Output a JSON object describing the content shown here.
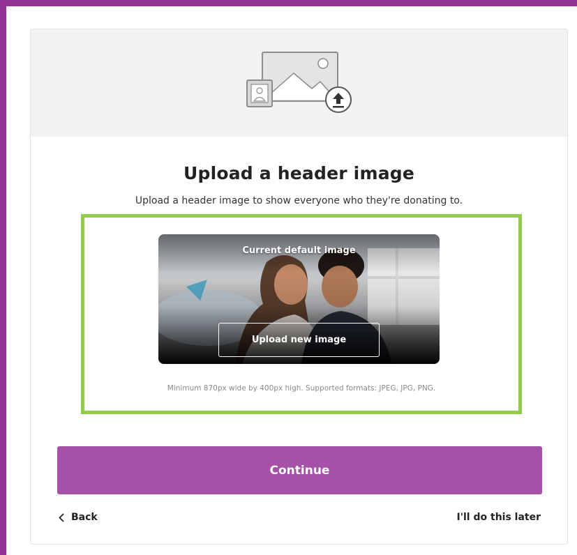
{
  "header": {
    "illustration_icon": "image-upload-icon"
  },
  "main": {
    "title": "Upload a header image",
    "subtitle": "Upload a header image to show everyone who they're donating to."
  },
  "upload": {
    "preview_label": "Current default image",
    "upload_button_label": "Upload new image",
    "requirements": "Minimum 870px wide by 400px high. Supported formats: JPEG, JPG, PNG."
  },
  "actions": {
    "continue_label": "Continue",
    "back_label": "Back",
    "later_label": "I'll do this later"
  },
  "colors": {
    "page_border": "#933495",
    "accent": "#a650a8",
    "highlight": "#8fcd4a"
  }
}
